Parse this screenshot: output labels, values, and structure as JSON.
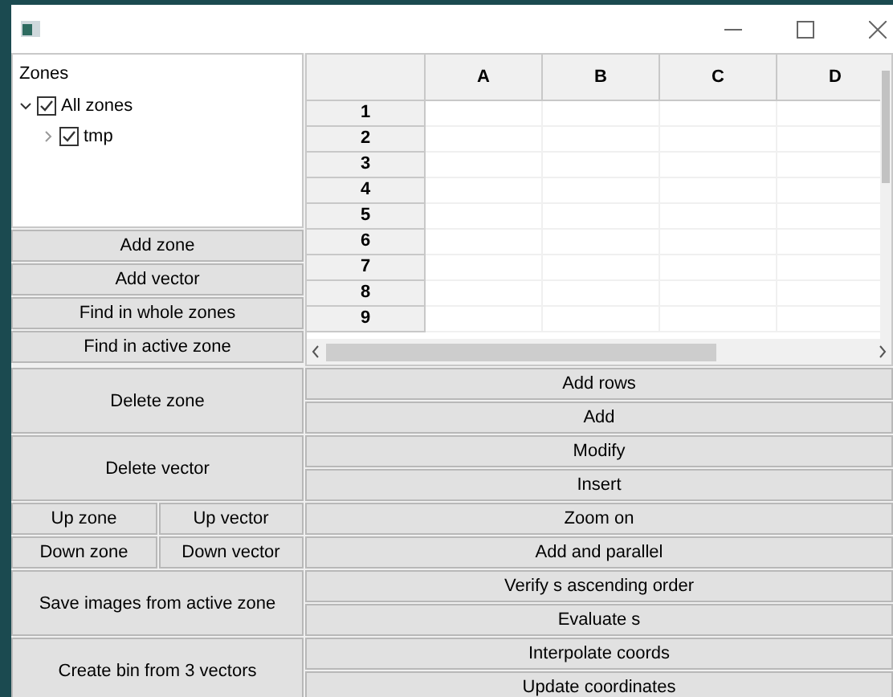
{
  "tree": {
    "header": "Zones",
    "items": [
      {
        "label": "All zones",
        "checked": true,
        "expanded": true,
        "children": [
          {
            "label": "tmp",
            "checked": true,
            "expanded": false
          }
        ]
      }
    ]
  },
  "left_buttons": [
    "Add zone",
    "Add vector",
    "Find in whole zones",
    "Find in active zone"
  ],
  "table": {
    "columns": [
      "A",
      "B",
      "C",
      "D"
    ],
    "rows": [
      "1",
      "2",
      "3",
      "4",
      "5",
      "6",
      "7",
      "8",
      "9"
    ]
  },
  "left_actions": [
    {
      "kind": "wide",
      "label": "Delete zone"
    },
    {
      "kind": "wide",
      "label": "Delete vector"
    },
    {
      "kind": "pair",
      "labels": [
        "Up zone",
        "Up vector"
      ]
    },
    {
      "kind": "pair",
      "labels": [
        "Down zone",
        "Down vector"
      ]
    },
    {
      "kind": "wide",
      "label": "Save images from active zone"
    },
    {
      "kind": "wide",
      "label": "Create bin from 3 vectors"
    }
  ],
  "right_actions": [
    "Add rows",
    "Add",
    "Modify",
    "Insert",
    "Zoom on",
    "Add and parallel",
    "Verify s ascending order",
    "Evaluate s",
    "Interpolate coords",
    "Update coordinates"
  ]
}
